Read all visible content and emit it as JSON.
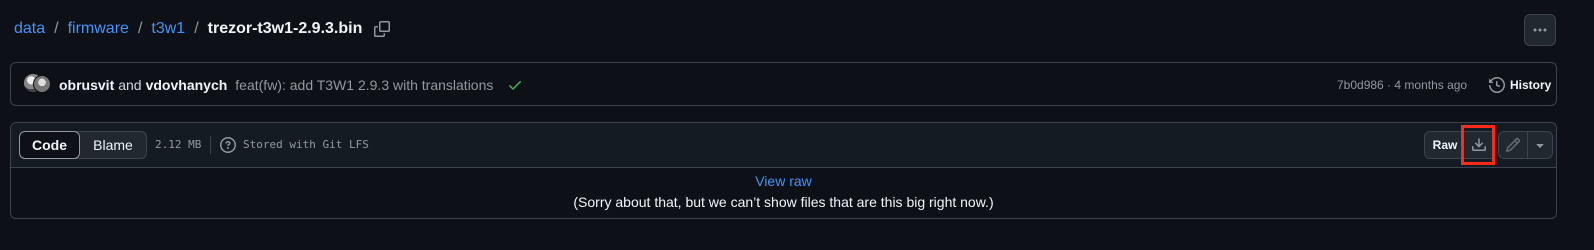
{
  "breadcrumb": {
    "items": [
      "data",
      "firmware",
      "t3w1"
    ],
    "separator": "/",
    "current": "trezor-t3w1-2.9.3.bin"
  },
  "header": {
    "more_icon": "kebab-horizontal-icon",
    "copy_icon": "copy-icon"
  },
  "commit": {
    "author1": "obrusvit",
    "and": "and",
    "author2": "vdovhanych",
    "message": "feat(fw): add T3W1 2.9.3 with translations",
    "status_icon": "check-icon",
    "sha": "7b0d986",
    "separator": " · ",
    "time": "4 months ago",
    "history_label": "History"
  },
  "file": {
    "tabs": [
      "Code",
      "Blame"
    ],
    "active_tab": "Code",
    "size": "2.12 MB",
    "lfs_label": "Stored with Git LFS",
    "raw_label": "Raw",
    "view_raw": "View raw",
    "too_big_message": "(Sorry about that, but we can’t show files that are this big right now.)"
  },
  "colors": {
    "background": "#0d1117",
    "link": "#4493f8",
    "border": "#3d444d",
    "success": "#3fb950",
    "highlight": "#ff2a1a"
  }
}
